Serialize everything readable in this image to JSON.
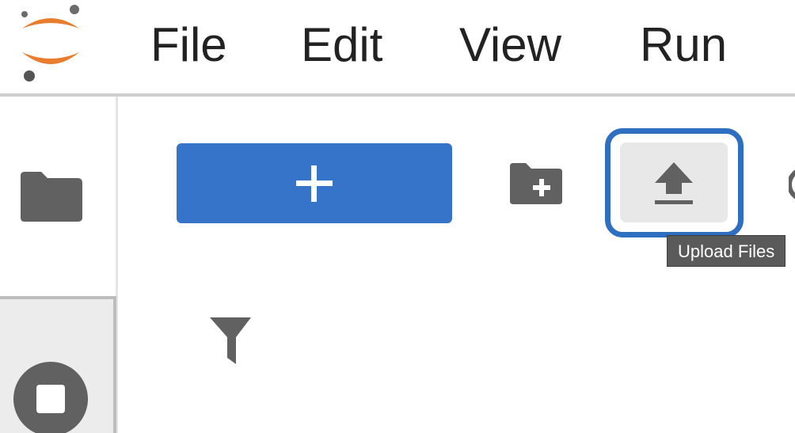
{
  "app": {
    "logo_icon": "jupyter-logo-icon",
    "accent_orange": "#e87d2e",
    "dot_gray": "#555555"
  },
  "menubar": {
    "items": [
      {
        "label": "File"
      },
      {
        "label": "Edit"
      },
      {
        "label": "View"
      },
      {
        "label": "Run"
      }
    ]
  },
  "sidebar": {
    "tabs": [
      {
        "icon": "folder-icon",
        "active": false
      },
      {
        "icon": "stop-circle-icon",
        "active": true
      }
    ]
  },
  "toolbar": {
    "new_launcher_icon": "plus-icon",
    "new_launcher_color": "#3574c9",
    "new_folder_icon": "folder-plus-icon",
    "upload_icon": "upload-icon",
    "refresh_icon": "refresh-icon",
    "upload_tooltip": "Upload Files",
    "focus_ring_color": "#2f6fc1"
  },
  "filebrowser": {
    "filter_icon": "filter-icon"
  }
}
